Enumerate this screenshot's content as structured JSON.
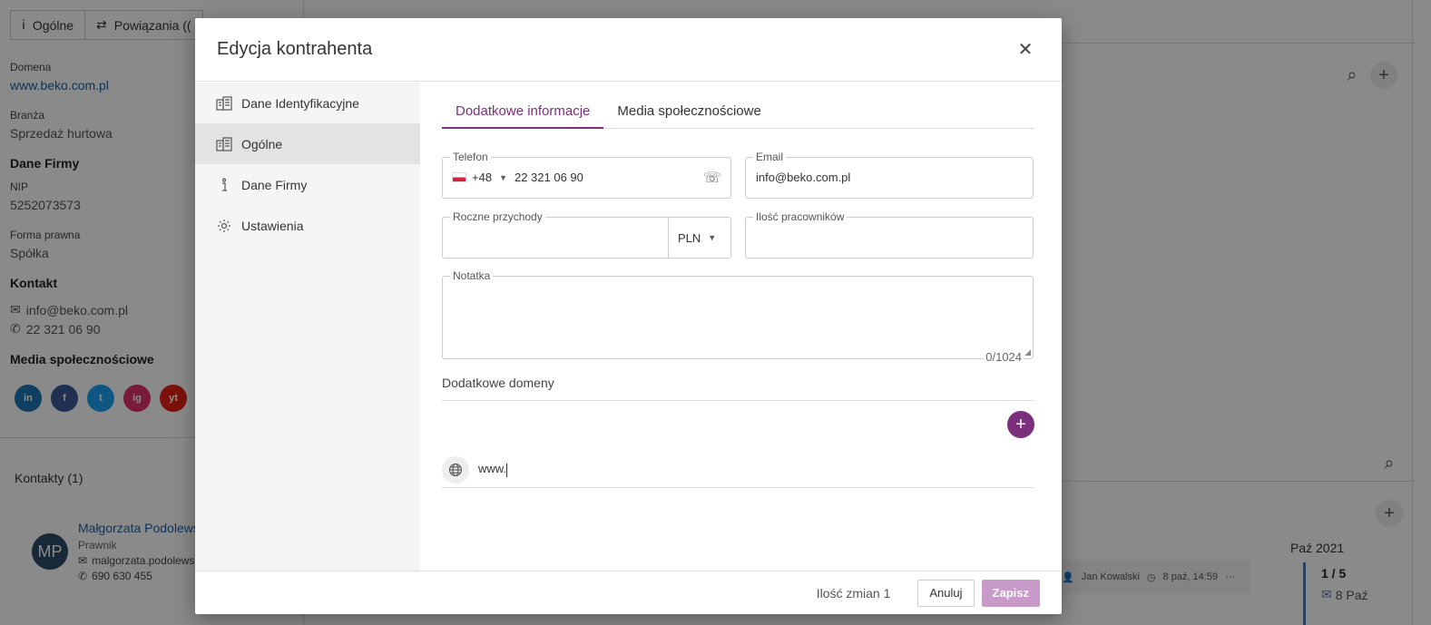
{
  "background": {
    "tabs": [
      "Ogólne",
      "Powiązania (("
    ],
    "domain_label": "Domena",
    "domain_value": "www.beko.com.pl",
    "industry_label": "Branża",
    "industry_value": "Sprzedaż hurtowa",
    "company_section": "Dane Firmy",
    "nip_label": "NIP",
    "nip_value": "5252073573",
    "legal_form_label": "Forma prawna",
    "legal_form_value": "Spółka",
    "contact_section": "Kontakt",
    "contact_email": "info@beko.com.pl",
    "contact_phone": "22 321 06 90",
    "social_section": "Media społecznościowe",
    "social_icons": [
      "in",
      "f",
      "t",
      "ig",
      "yt"
    ],
    "contacts_title": "Kontakty (1)",
    "person": {
      "initials": "MP",
      "name": "Małgorzata Podolews",
      "role": "Prawnik",
      "email": "malgorzata.podolews",
      "phone": "690 630 455"
    },
    "event_user": "Jan Kowalski",
    "event_time": "8 paź, 14:59",
    "month": "Paź 2021",
    "count": "1 / 5",
    "date": "8 Paź"
  },
  "modal": {
    "title": "Edycja kontrahenta",
    "nav": [
      {
        "label": "Dane Identyfikacyjne",
        "icon": "building-icon"
      },
      {
        "label": "Ogólne",
        "icon": "building-icon"
      },
      {
        "label": "Dane Firmy",
        "icon": "info-icon"
      },
      {
        "label": "Ustawienia",
        "icon": "gear-icon"
      }
    ],
    "tabs": [
      "Dodatkowe informacje",
      "Media społecznościowe"
    ],
    "phone": {
      "label": "Telefon",
      "prefix": "+48",
      "value": "22 321 06 90"
    },
    "email": {
      "label": "Email",
      "value": "info@beko.com.pl"
    },
    "revenue": {
      "label": "Roczne przychody",
      "value": "",
      "currency": "PLN"
    },
    "employees": {
      "label": "Ilość pracowników",
      "value": ""
    },
    "note": {
      "label": "Notatka",
      "value": "",
      "counter": "0/1024"
    },
    "domains": {
      "label": "Dodatkowe domeny",
      "value": "www."
    },
    "footer": {
      "changes": "Ilość zmian 1",
      "cancel": "Anuluj",
      "save": "Zapisz"
    }
  },
  "colors": {
    "accent": "#7b2f7d",
    "save_disabled": "#c79ac9",
    "link": "#1a5fa0"
  }
}
